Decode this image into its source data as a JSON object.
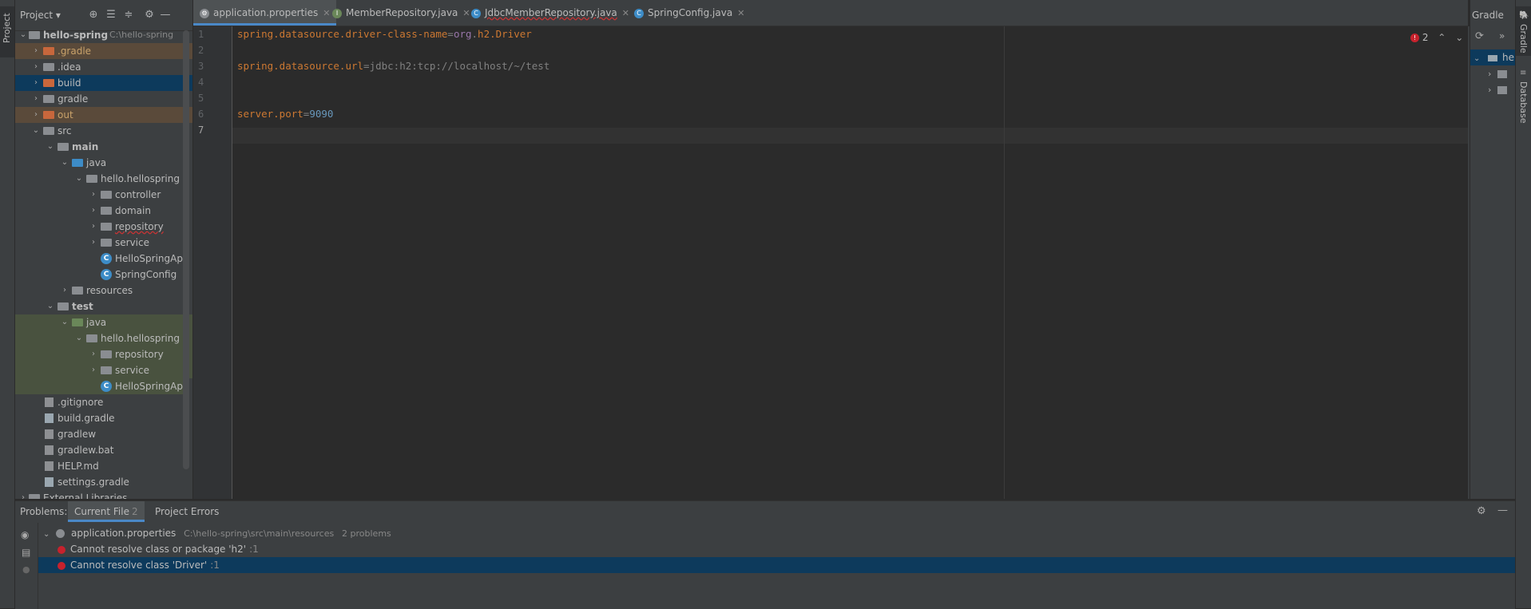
{
  "left_stripe": {
    "project_tab": "Project"
  },
  "project_panel": {
    "title": "Project",
    "tree": [
      {
        "label": "hello-spring",
        "hint": "C:\\hello-spring",
        "bold": true
      },
      {
        "label": ".gradle"
      },
      {
        "label": ".idea"
      },
      {
        "label": "build"
      },
      {
        "label": "gradle"
      },
      {
        "label": "out"
      },
      {
        "label": "src"
      },
      {
        "label": "main",
        "bold": true
      },
      {
        "label": "java"
      },
      {
        "label": "hello.hellospring"
      },
      {
        "label": "controller"
      },
      {
        "label": "domain"
      },
      {
        "label": "repository"
      },
      {
        "label": "service"
      },
      {
        "label": "HelloSpringApplication"
      },
      {
        "label": "SpringConfig"
      },
      {
        "label": "resources"
      },
      {
        "label": "test",
        "bold": true
      },
      {
        "label": "java"
      },
      {
        "label": "hello.hellospring"
      },
      {
        "label": "repository"
      },
      {
        "label": "service"
      },
      {
        "label": "HelloSpringApplicationTests"
      },
      {
        "label": ".gitignore"
      },
      {
        "label": "build.gradle"
      },
      {
        "label": "gradlew"
      },
      {
        "label": "gradlew.bat"
      },
      {
        "label": "HELP.md"
      },
      {
        "label": "settings.gradle"
      },
      {
        "label": "External Libraries"
      }
    ]
  },
  "tabs": [
    {
      "label": "application.properties",
      "active": true
    },
    {
      "label": "MemberRepository.java"
    },
    {
      "label": "JdbcMemberRepository.java"
    },
    {
      "label": "SpringConfig.java"
    }
  ],
  "editor": {
    "line_numbers": [
      "1",
      "2",
      "3",
      "4",
      "5",
      "6",
      "7"
    ],
    "line1": {
      "key": "spring.datasource.driver-class-name",
      "eq": "=",
      "v1": "org",
      "dot": ".",
      "v2": "h2",
      "v3": ".Driver"
    },
    "line3": {
      "key": "spring.datasource.url",
      "eq": "=",
      "val": "jdbc:h2:tcp://localhost/~/test"
    },
    "line6": {
      "key": "server.port",
      "eq": "=",
      "val": "9090"
    },
    "error_count": "2"
  },
  "gradle_panel": {
    "title": "Gradle",
    "project_abbrev": "hel"
  },
  "right_stripe": {
    "gradle_tab": "Gradle",
    "database_tab": "Database"
  },
  "problems": {
    "title": "Problems:",
    "tabs": [
      {
        "label": "Current File",
        "count": "2",
        "active": true
      },
      {
        "label": "Project Errors"
      }
    ],
    "file": {
      "name": "application.properties",
      "path": "C:\\hello-spring\\src\\main\\resources",
      "count": "2 problems"
    },
    "items": [
      {
        "message": "Cannot resolve class or package 'h2'",
        "loc": ":1"
      },
      {
        "message": "Cannot resolve class 'Driver'",
        "loc": ":1",
        "selected": true
      }
    ]
  },
  "colors": {
    "accent": "#4a88c7",
    "error": "#c7222d",
    "selection": "#0d3a5c"
  }
}
